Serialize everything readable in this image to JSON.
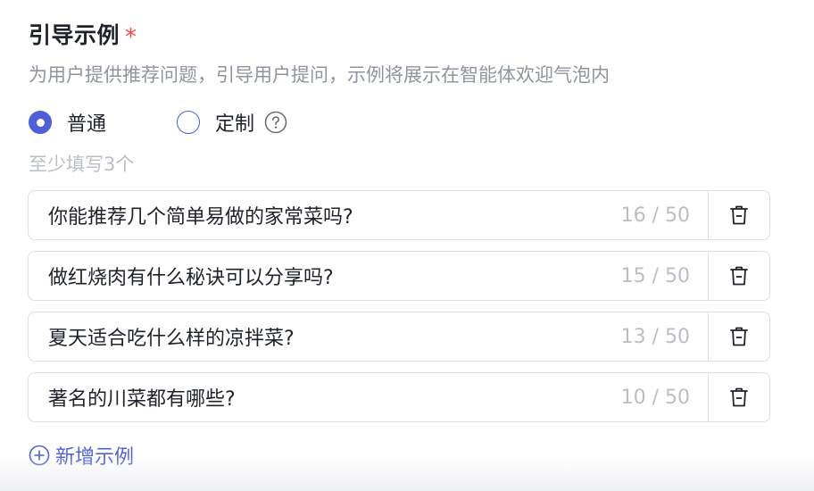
{
  "section": {
    "title": "引导示例",
    "required_mark": "*",
    "description": "为用户提供推荐问题，引导用户提问，示例将展示在智能体欢迎气泡内"
  },
  "mode": {
    "options": [
      {
        "label": "普通",
        "checked": true
      },
      {
        "label": "定制",
        "checked": false
      }
    ],
    "help_icon": "question-circle-icon"
  },
  "hint": "至少填写3个",
  "examples": [
    {
      "text": "你能推荐几个简单易做的家常菜吗?",
      "counter": "16 / 50"
    },
    {
      "text": "做红烧肉有什么秘诀可以分享吗?",
      "counter": "15 / 50"
    },
    {
      "text": "夏天适合吃什么样的凉拌菜?",
      "counter": "13 / 50"
    },
    {
      "text": "著名的川菜都有哪些?",
      "counter": "10 / 50"
    }
  ],
  "delete_icon": "trash-icon",
  "add_button": {
    "label": "新增示例",
    "icon": "plus-circle-icon"
  },
  "colors": {
    "accent": "#4e5fd8",
    "required": "#f54a45",
    "muted_text": "#8f959e",
    "placeholder_text": "#bbbfc4",
    "border": "#dee0e3"
  }
}
